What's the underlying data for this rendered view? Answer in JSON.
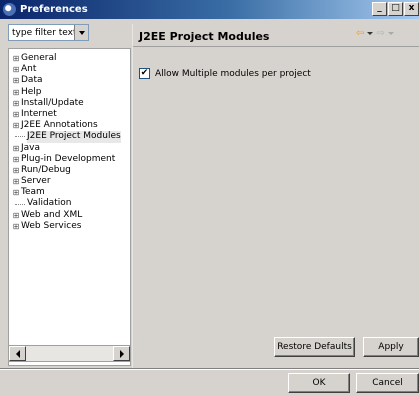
{
  "window": {
    "title": "Preferences",
    "controls": [
      "_",
      "□",
      "x"
    ]
  },
  "filter": {
    "value": "type filter text"
  },
  "tree": {
    "items": [
      {
        "label": "General",
        "expandable": true
      },
      {
        "label": "Ant",
        "expandable": true
      },
      {
        "label": "Data",
        "expandable": true
      },
      {
        "label": "Help",
        "expandable": true
      },
      {
        "label": "Install/Update",
        "expandable": true
      },
      {
        "label": "Internet",
        "expandable": true
      },
      {
        "label": "J2EE Annotations",
        "expandable": true
      },
      {
        "label": "J2EE Project Modules",
        "expandable": false,
        "selected": true
      },
      {
        "label": "Java",
        "expandable": true
      },
      {
        "label": "Plug-in Development",
        "expandable": true
      },
      {
        "label": "Run/Debug",
        "expandable": true
      },
      {
        "label": "Server",
        "expandable": true
      },
      {
        "label": "Team",
        "expandable": true
      },
      {
        "label": "Validation",
        "expandable": false
      },
      {
        "label": "Web and XML",
        "expandable": true
      },
      {
        "label": "Web Services",
        "expandable": true
      }
    ]
  },
  "page": {
    "title": "J2EE Project Modules",
    "checkbox_label": "Allow Multiple modules per project",
    "checkbox_checked": true
  },
  "buttons": {
    "restore_defaults": "Restore Defaults",
    "apply": "Apply",
    "ok": "OK",
    "cancel": "Cancel"
  }
}
